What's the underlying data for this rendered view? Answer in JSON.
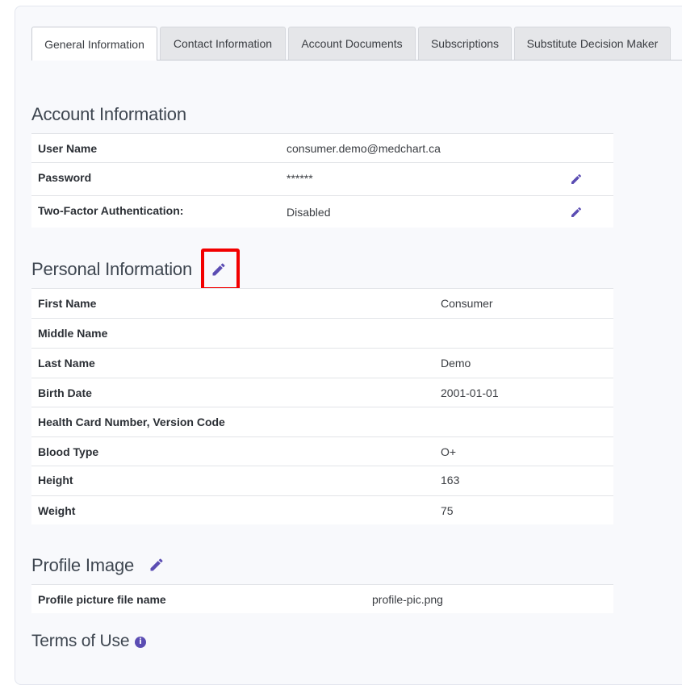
{
  "tabs": [
    {
      "label": "General Information",
      "active": true
    },
    {
      "label": "Contact Information",
      "active": false
    },
    {
      "label": "Account Documents",
      "active": false
    },
    {
      "label": "Subscriptions",
      "active": false
    },
    {
      "label": "Substitute Decision Maker",
      "active": false
    }
  ],
  "account": {
    "title": "Account Information",
    "rows": [
      {
        "label": "User Name",
        "value": "consumer.demo@medchart.ca"
      },
      {
        "label": "Password",
        "value": "******"
      },
      {
        "label": "Two-Factor Authentication:",
        "value": "Disabled"
      }
    ]
  },
  "personal": {
    "title": "Personal Information",
    "rows": [
      {
        "label": "First Name",
        "value": "Consumer"
      },
      {
        "label": "Middle Name",
        "value": ""
      },
      {
        "label": "Last Name",
        "value": "Demo"
      },
      {
        "label": "Birth Date",
        "value": "2001-01-01"
      },
      {
        "label": "Health Card Number, Version Code",
        "value": ""
      },
      {
        "label": "Blood Type",
        "value": "O+"
      },
      {
        "label": "Height",
        "value": "163"
      },
      {
        "label": "Weight",
        "value": "75"
      }
    ]
  },
  "profile_image": {
    "title": "Profile Image",
    "rows": [
      {
        "label": "Profile picture file name",
        "value": "profile-pic.png"
      }
    ]
  },
  "terms": {
    "title": "Terms of Use",
    "info_icon": "info-circle-icon"
  },
  "colors": {
    "accent": "#5b4db3",
    "highlight": "#f20000"
  }
}
